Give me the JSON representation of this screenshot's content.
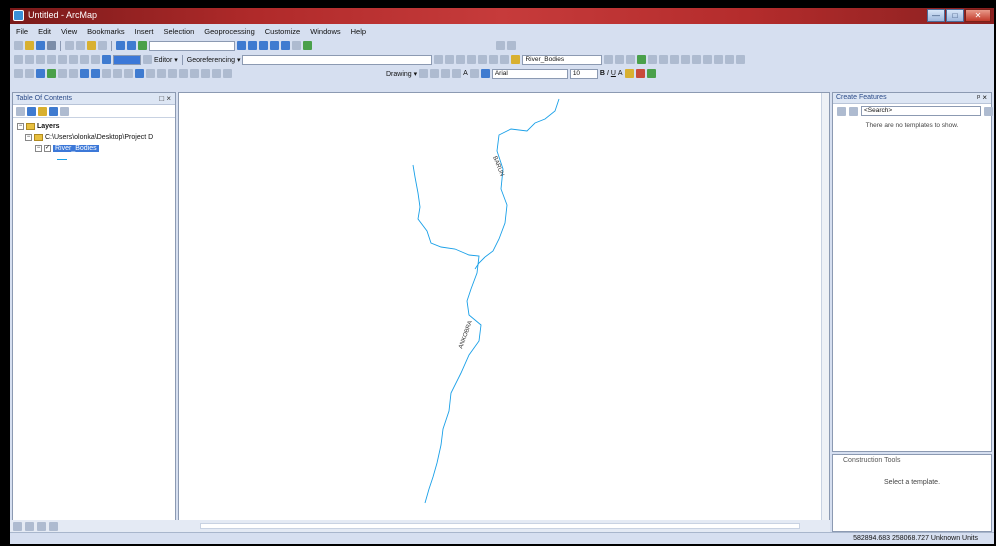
{
  "window": {
    "title": "Untitled - ArcMap",
    "controls": [
      "—",
      "□",
      "✕"
    ]
  },
  "menu": [
    "File",
    "Edit",
    "View",
    "Bookmarks",
    "Insert",
    "Selection",
    "Geoprocessing",
    "Customize",
    "Windows",
    "Help"
  ],
  "toolbar": {
    "editor_label": "Editor ▾",
    "georef_label": "Georeferencing ▾",
    "layer_combo": "River_Bodies",
    "drawing_label": "Drawing ▾",
    "font_combo": "Arial",
    "font_size": "10",
    "bold": "B",
    "italic": "I",
    "underline": "U",
    "text_tool": "A"
  },
  "toc": {
    "title": "Table Of Contents",
    "close": "□ ×",
    "layers_label": "Layers",
    "path_label": "C:\\Users\\olonka\\Desktop\\Project D",
    "layer_label": "River_Bodies",
    "collapse": "−",
    "checked": "✓"
  },
  "map": {
    "river_labels": [
      "BARUN",
      "ANKOBRA"
    ]
  },
  "create_features": {
    "title": "Create Features",
    "pin_close": "ᵖ ×",
    "search_placeholder": "<Search>",
    "empty_message": "There are no templates to show."
  },
  "construction_tools": {
    "title": "Construction Tools",
    "message": "Select a template."
  },
  "status": {
    "coordinates": "582894.683  258068.727 Unknown Units"
  },
  "colors": {
    "title_bar": "#b02a2a",
    "river": "#1aa0e8",
    "selection": "#3c78d8"
  }
}
